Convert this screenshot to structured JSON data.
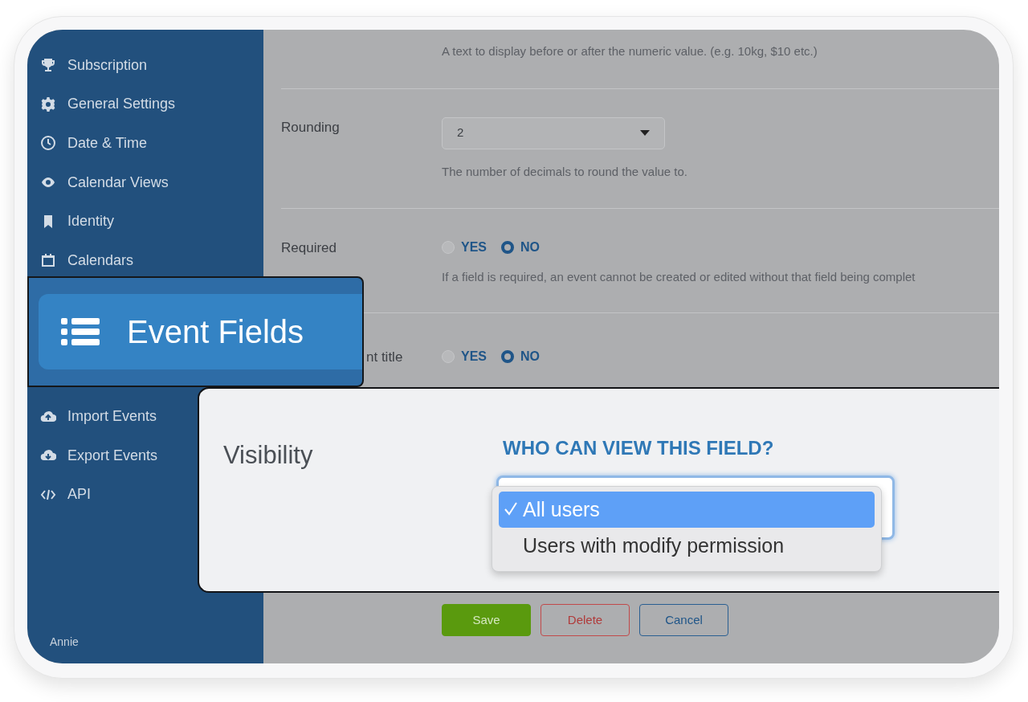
{
  "sidebar": {
    "items": [
      {
        "label": "Subscription"
      },
      {
        "label": "General Settings"
      },
      {
        "label": "Date & Time"
      },
      {
        "label": "Calendar Views"
      },
      {
        "label": "Identity"
      },
      {
        "label": "Calendars"
      }
    ],
    "lower_items": [
      {
        "label": "Import Events"
      },
      {
        "label": "Export Events"
      },
      {
        "label": "API"
      }
    ],
    "user": "Annie"
  },
  "callout": {
    "label": "Event Fields"
  },
  "form": {
    "suffix_hint": "A text to display before or after the numeric value. (e.g. 10kg, $10 etc.)",
    "rows": [
      {
        "kind": "select",
        "label": "Rounding",
        "value": "2",
        "hint": "The number of decimals to round the value to."
      },
      {
        "kind": "radio",
        "label": "Required",
        "options": [
          {
            "label": "YES",
            "selected": false
          },
          {
            "label": "NO",
            "selected": true
          }
        ],
        "hint": "If a field is required, an event cannot be created or edited without that field being complet"
      },
      {
        "kind": "radio",
        "label": "nt title",
        "options": [
          {
            "label": "YES",
            "selected": false
          },
          {
            "label": "NO",
            "selected": true
          }
        ]
      }
    ],
    "buttons": [
      {
        "kind": "save",
        "label": "Save"
      },
      {
        "kind": "delete",
        "label": "Delete"
      },
      {
        "kind": "cancel",
        "label": "Cancel"
      }
    ]
  },
  "visibility": {
    "label": "Visibility",
    "heading": "WHO CAN VIEW THIS FIELD?",
    "options": [
      {
        "label": "All users",
        "selected": true
      },
      {
        "label": "Users with modify permission",
        "selected": false
      }
    ]
  }
}
